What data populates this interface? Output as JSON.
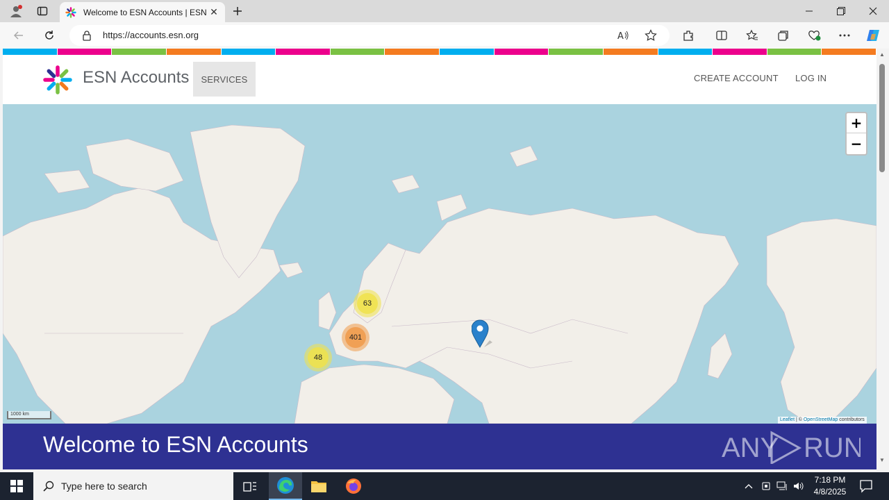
{
  "browser": {
    "tab_title": "Welcome to ESN Accounts | ESN",
    "url": "https://accounts.esn.org"
  },
  "site": {
    "brand": "ESN Accounts",
    "nav": {
      "services": "SERVICES",
      "create_account": "CREATE ACCOUNT",
      "log_in": "LOG IN"
    },
    "stripe_colors": [
      "#00aeef",
      "#ec008c",
      "#7ac143",
      "#f47b20",
      "#00aeef",
      "#ec008c",
      "#7ac143",
      "#f47b20",
      "#00aeef",
      "#ec008c",
      "#7ac143",
      "#f47b20",
      "#00aeef",
      "#ec008c",
      "#7ac143",
      "#f47b20"
    ],
    "welcome_title": "Welcome to ESN Accounts"
  },
  "map": {
    "zoom_in": "+",
    "zoom_out": "−",
    "clusters": [
      {
        "label": "63",
        "size": "small"
      },
      {
        "label": "401",
        "size": "large"
      },
      {
        "label": "48",
        "size": "small"
      }
    ],
    "scale_label": "1000 km",
    "attribution_leaflet": "Leaflet",
    "attribution_sep": " | © ",
    "attribution_osm": "OpenStreetMap",
    "attribution_suffix": " contributors",
    "colors": {
      "water": "#aad3df",
      "land": "#f2efe9",
      "cluster_small": "#f0e24a",
      "cluster_large": "#f09a4a",
      "marker": "#2a81cb"
    }
  },
  "watermark": "ANY RUN",
  "taskbar": {
    "search_placeholder": "Type here to search",
    "time": "7:18 PM",
    "date": "4/8/2025"
  }
}
